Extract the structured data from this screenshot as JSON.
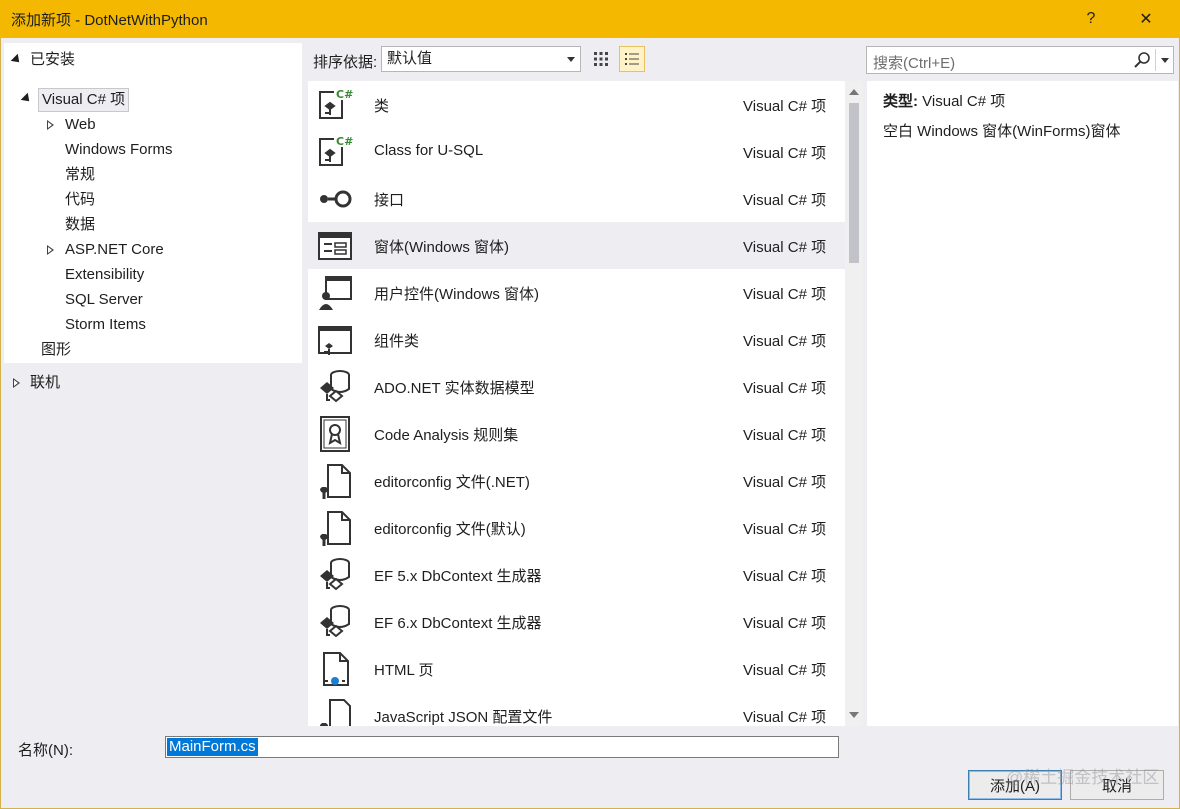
{
  "window": {
    "title": "添加新项 - DotNetWithPython",
    "help_label": "?",
    "close_label": "✕"
  },
  "tree": {
    "installed": "已安装",
    "nodes": {
      "visual_csharp": "Visual C# 项",
      "web": "Web",
      "windows_forms": "Windows Forms",
      "general": "常规",
      "code": "代码",
      "data": "数据",
      "aspnet_core": "ASP.NET Core",
      "extensibility": "Extensibility",
      "sql_server": "SQL Server",
      "storm_items": "Storm Items",
      "graphics": "图形"
    },
    "online": "联机"
  },
  "toolbar": {
    "sort_label": "排序依据:",
    "sort_value": "默认值",
    "search_placeholder": "搜索(Ctrl+E)"
  },
  "items": [
    {
      "name": "类",
      "type": "Visual C# 项",
      "icon": "class-icon"
    },
    {
      "name": "Class for U-SQL",
      "type": "Visual C# 项",
      "icon": "class-icon"
    },
    {
      "name": "接口",
      "type": "Visual C# 项",
      "icon": "interface-icon"
    },
    {
      "name": "窗体(Windows 窗体)",
      "type": "Visual C# 项",
      "icon": "form-icon"
    },
    {
      "name": "用户控件(Windows 窗体)",
      "type": "Visual C# 项",
      "icon": "user-control-icon"
    },
    {
      "name": "组件类",
      "type": "Visual C# 项",
      "icon": "component-icon"
    },
    {
      "name": "ADO.NET 实体数据模型",
      "type": "Visual C# 项",
      "icon": "entity-model-icon"
    },
    {
      "name": "Code Analysis 规则集",
      "type": "Visual C# 项",
      "icon": "ruleset-icon"
    },
    {
      "name": "editorconfig 文件(.NET)",
      "type": "Visual C# 项",
      "icon": "config-file-icon"
    },
    {
      "name": "editorconfig 文件(默认)",
      "type": "Visual C# 项",
      "icon": "config-file-icon"
    },
    {
      "name": "EF 5.x DbContext 生成器",
      "type": "Visual C# 项",
      "icon": "entity-model-icon"
    },
    {
      "name": "EF 6.x DbContext 生成器",
      "type": "Visual C# 项",
      "icon": "entity-model-icon"
    },
    {
      "name": "HTML 页",
      "type": "Visual C# 项",
      "icon": "html-page-icon"
    },
    {
      "name": "JavaScript JSON 配置文件",
      "type": "Visual C# 项",
      "icon": "json-config-icon"
    }
  ],
  "detail": {
    "type_label": "类型:",
    "type_value": "Visual C# 项",
    "description": "空白 Windows 窗体(WinForms)窗体"
  },
  "footer": {
    "name_label": "名称(N):",
    "name_value": "MainForm.cs",
    "add_label": "添加(A)",
    "cancel_label": "取消",
    "watermark": "@稀土掘金技术社区"
  }
}
